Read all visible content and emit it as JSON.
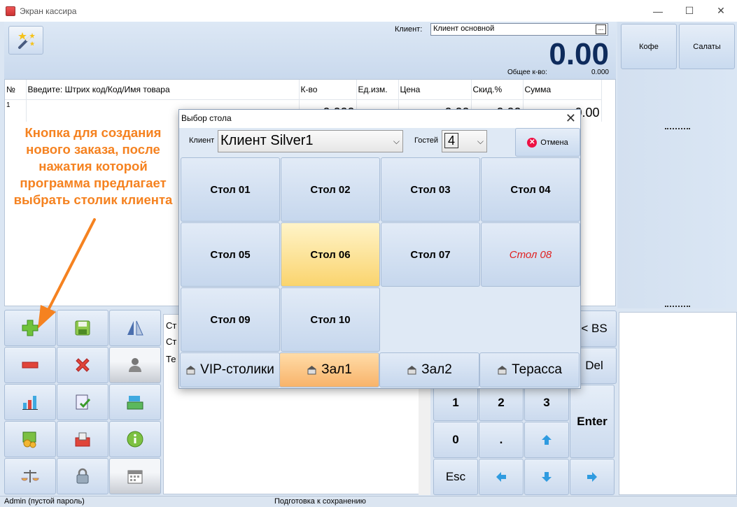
{
  "window": {
    "title": "Экран кассира"
  },
  "header": {
    "client_label": "Клиент:",
    "client_value": "Клиент основной",
    "client_button": "...",
    "total": "0.00",
    "qty_label": "Общее к-во:",
    "qty_value": "0.000"
  },
  "categories": [
    {
      "label": "Кофе"
    },
    {
      "label": "Салаты"
    }
  ],
  "grid": {
    "columns": [
      "№",
      "Введите: Штрих код/Код/Имя товара",
      "К-во",
      "Ед.изм.",
      "Цена",
      "Скид.%",
      "Сумма"
    ],
    "rows": [
      {
        "num": "1",
        "name": "",
        "qty": "0.000",
        "unit": "",
        "price": "0.00",
        "disc": "0.00",
        "sum": "0.00"
      }
    ]
  },
  "annotation": {
    "lines": [
      "Кнопка для создания",
      "нового заказа, после",
      "нажатия которой",
      "программа  предлагает",
      "выбрать столик клиента"
    ]
  },
  "info_panel": {
    "lines": [
      "Ст",
      "Ст",
      "Те"
    ]
  },
  "numpad": {
    "k1": "1",
    "k2": "2",
    "k3": "3",
    "k0": "0",
    "dot": ".",
    "bs": "< BS",
    "del": "Del",
    "enter": "Enter",
    "esc": "Esc"
  },
  "dialog": {
    "title": "Выбор стола",
    "client_label": "Клиент",
    "client_value": "Клиент Silver1",
    "guests_label": "Гостей",
    "guests_value": "4",
    "cancel_label": "Отмена",
    "tables": [
      {
        "label": "Стол 01",
        "state": "normal"
      },
      {
        "label": "Стол 02",
        "state": "normal"
      },
      {
        "label": "Стол 03",
        "state": "normal"
      },
      {
        "label": "Стол 04",
        "state": "normal"
      },
      {
        "label": "Стол 05",
        "state": "normal"
      },
      {
        "label": "Стол 06",
        "state": "selected"
      },
      {
        "label": "Стол 07",
        "state": "normal"
      },
      {
        "label": "Стол 08",
        "state": "busy"
      },
      {
        "label": "Стол 09",
        "state": "normal"
      },
      {
        "label": "Стол 10",
        "state": "normal"
      }
    ],
    "halls": [
      {
        "label": "VIP-столики",
        "state": "normal"
      },
      {
        "label": "Зал1",
        "state": "selected"
      },
      {
        "label": "Зал2",
        "state": "normal"
      },
      {
        "label": "Терасса",
        "state": "normal"
      }
    ]
  },
  "status": {
    "user": "Admin (пустой пароль)",
    "message": "Подготовка к сохранению"
  },
  "colors": {
    "accent_total": "#0e2b5c",
    "annotation": "#f58220",
    "busy_table": "#e02020",
    "selected_table": "#fad46e",
    "selected_hall": "#f8b36a"
  }
}
